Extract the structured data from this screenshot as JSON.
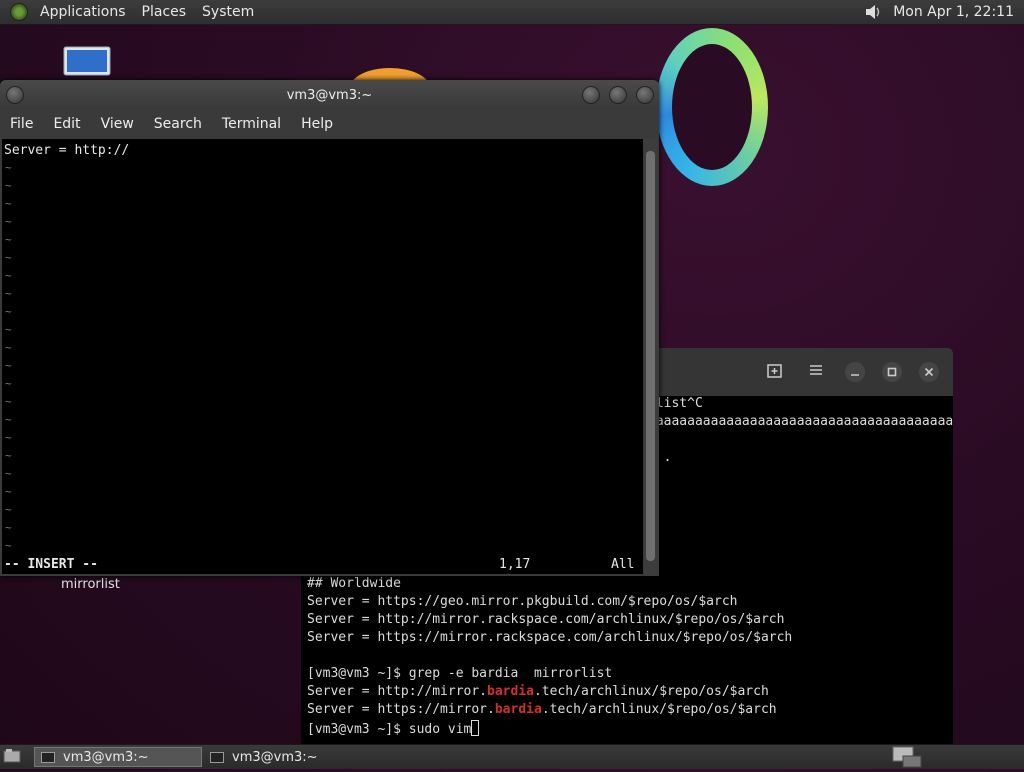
{
  "top_panel": {
    "menus": [
      "Applications",
      "Places",
      "System"
    ],
    "clock": "Mon Apr 1, 22:11"
  },
  "desktop": {
    "file_label": "mirrorlist"
  },
  "vim_window": {
    "title": "vm3@vm3:~",
    "menu": [
      "File",
      "Edit",
      "View",
      "Search",
      "Terminal",
      "Help"
    ],
    "line1": "Server = http://",
    "tilde": "~",
    "mode": "-- INSERT --",
    "position": "1,17",
    "scroll": "All"
  },
  "back_terminal": {
    "partial_lines": [
      "rlist^C",
      "aaaaaaaaaaaaaaaaaaaaaaaaaaaaaaaaaaaaaaaaa",
      "t ."
    ],
    "lines": [
      "## Worldwide",
      "Server = https://geo.mirror.pkgbuild.com/$repo/os/$arch",
      "Server = http://mirror.rackspace.com/archlinux/$repo/os/$arch",
      "Server = https://mirror.rackspace.com/archlinux/$repo/os/$arch",
      "",
      "[vm3@vm3 ~]$ grep -e bardia  mirrorlist"
    ],
    "match1": {
      "pre": "Server = http://mirror.",
      "hl": "bardia",
      "post": ".tech/archlinux/$repo/os/$arch"
    },
    "match2": {
      "pre": "Server = https://mirror.",
      "hl": "bardia",
      "post": ".tech/archlinux/$repo/os/$arch"
    },
    "prompt": "[vm3@vm3 ~]$ sudo vim"
  },
  "taskbar": {
    "task1": "vm3@vm3:~",
    "task2": "vm3@vm3:~"
  },
  "colors": {
    "highlight": "#d23030",
    "panel": "#2e2e2e",
    "desktop": "#2a0b24"
  }
}
